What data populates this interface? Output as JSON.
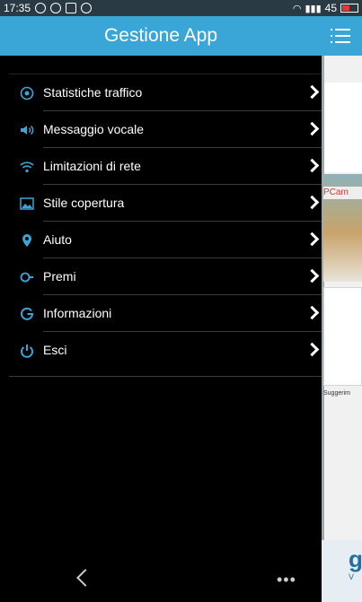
{
  "status_bar": {
    "time": "17:35",
    "signal": "",
    "battery_pct": "45"
  },
  "header": {
    "title": "Gestione App"
  },
  "menu": {
    "items": [
      {
        "label": "Statistiche traffico",
        "icon": "traffic-stats-icon",
        "color": "#3aa6d8"
      },
      {
        "label": "Messaggio vocale",
        "icon": "speaker-icon",
        "color": "#3aa6d8"
      },
      {
        "label": "Limitazioni di rete",
        "icon": "wifi-icon",
        "color": "#3aa6d8"
      },
      {
        "label": "Stile copertura",
        "icon": "image-icon",
        "color": "#3aa6d8"
      },
      {
        "label": "Aiuto",
        "icon": "location-pin-icon",
        "color": "#3aa6d8"
      },
      {
        "label": "Premi",
        "icon": "gift-icon",
        "color": "#3aa6d8"
      },
      {
        "label": "Informazioni",
        "icon": "info-g-icon",
        "color": "#3aa6d8"
      },
      {
        "label": "Esci",
        "icon": "power-icon",
        "color": "#3aa6d8"
      }
    ]
  },
  "peek": {
    "tag": "PCam",
    "suggest": "Suggerim",
    "big_letter": "g",
    "small_label": "V"
  },
  "colors": {
    "accent": "#3aa6d8",
    "drawer_bg": "#000000"
  }
}
